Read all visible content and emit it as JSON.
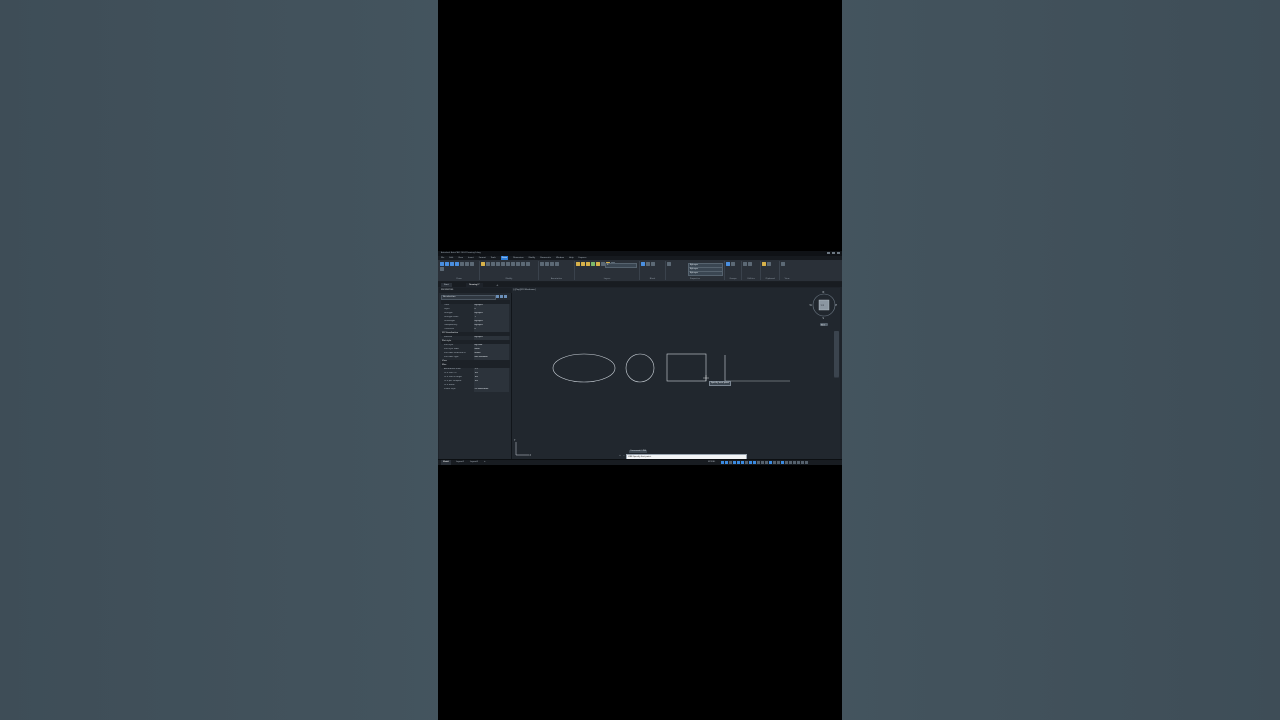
{
  "window": {
    "title": "Autodesk AutoCAD 2024   Drawing1.dwg"
  },
  "menu": {
    "items": [
      "File",
      "Edit",
      "View",
      "Insert",
      "Format",
      "Tools",
      "Draw",
      "Dimension",
      "Modify",
      "Parametric",
      "Window",
      "Help",
      "Express"
    ],
    "active_index": 6
  },
  "ribbon": {
    "groups": [
      {
        "label": "Draw"
      },
      {
        "label": "Modify"
      },
      {
        "label": "Annotation"
      },
      {
        "label": "Layers"
      },
      {
        "label": "Block"
      },
      {
        "label": "Properties"
      },
      {
        "label": "Groups"
      },
      {
        "label": "Utilities"
      },
      {
        "label": "Clipboard"
      },
      {
        "label": "View"
      }
    ],
    "layer_field": "0",
    "bylayer_1": "ByLayer",
    "bylayer_2": "ByLayer",
    "bylayer_3": "ByLayer"
  },
  "tabs": {
    "start": "Start",
    "drawing": "Drawing1*",
    "add": "+"
  },
  "properties_panel": {
    "title": "PROPERTIES",
    "selection": "No selection",
    "general_rows": [
      {
        "key": "Color",
        "value": "ByLayer"
      },
      {
        "key": "Layer",
        "value": "0"
      },
      {
        "key": "Linetype",
        "value": "ByLayer"
      },
      {
        "key": "Linetype scale",
        "value": "1"
      },
      {
        "key": "Lineweight",
        "value": "ByLayer"
      },
      {
        "key": "Transparency",
        "value": "ByLayer"
      },
      {
        "key": "Thickness",
        "value": "0"
      }
    ],
    "cat_3d": "3D Visualization",
    "material_row": {
      "key": "Material",
      "value": "ByLayer"
    },
    "cat_plot": "Plot style",
    "plot_rows": [
      {
        "key": "Plot style",
        "value": "ByColor"
      },
      {
        "key": "Plot style table",
        "value": "None"
      },
      {
        "key": "Plot table attached to",
        "value": "Model"
      },
      {
        "key": "Plot table type",
        "value": "Not available"
      }
    ],
    "cat_view": "View",
    "cat_misc": "Misc",
    "misc_rows": [
      {
        "key": "Annotation scale",
        "value": "1:1"
      },
      {
        "key": "UCS icon On",
        "value": "Yes"
      },
      {
        "key": "UCS icon at origin",
        "value": "Yes"
      },
      {
        "key": "UCS per viewport",
        "value": "Yes"
      },
      {
        "key": "UCS Name",
        "value": ""
      },
      {
        "key": "Visual Style",
        "value": "2D Wireframe"
      }
    ]
  },
  "viewport": {
    "label": "[-][Top][2D Wireframe]",
    "compass": {
      "n": "N",
      "s": "S",
      "e": "E",
      "w": "W",
      "center": "TOP",
      "wcs": "WCS"
    },
    "tooltip": "Specify next point"
  },
  "command": {
    "hint": "Command: LINE",
    "input": "LINE Specify first point:",
    "close_btn": "×",
    "search_btn": "⌕"
  },
  "status": {
    "layouts": [
      "Model",
      "Layout1",
      "Layout2",
      "+"
    ],
    "model": "MODEL"
  },
  "colors": {
    "accent": "#2c7bd6",
    "canvas": "#21272e",
    "geometry": "#cfd6dd"
  }
}
